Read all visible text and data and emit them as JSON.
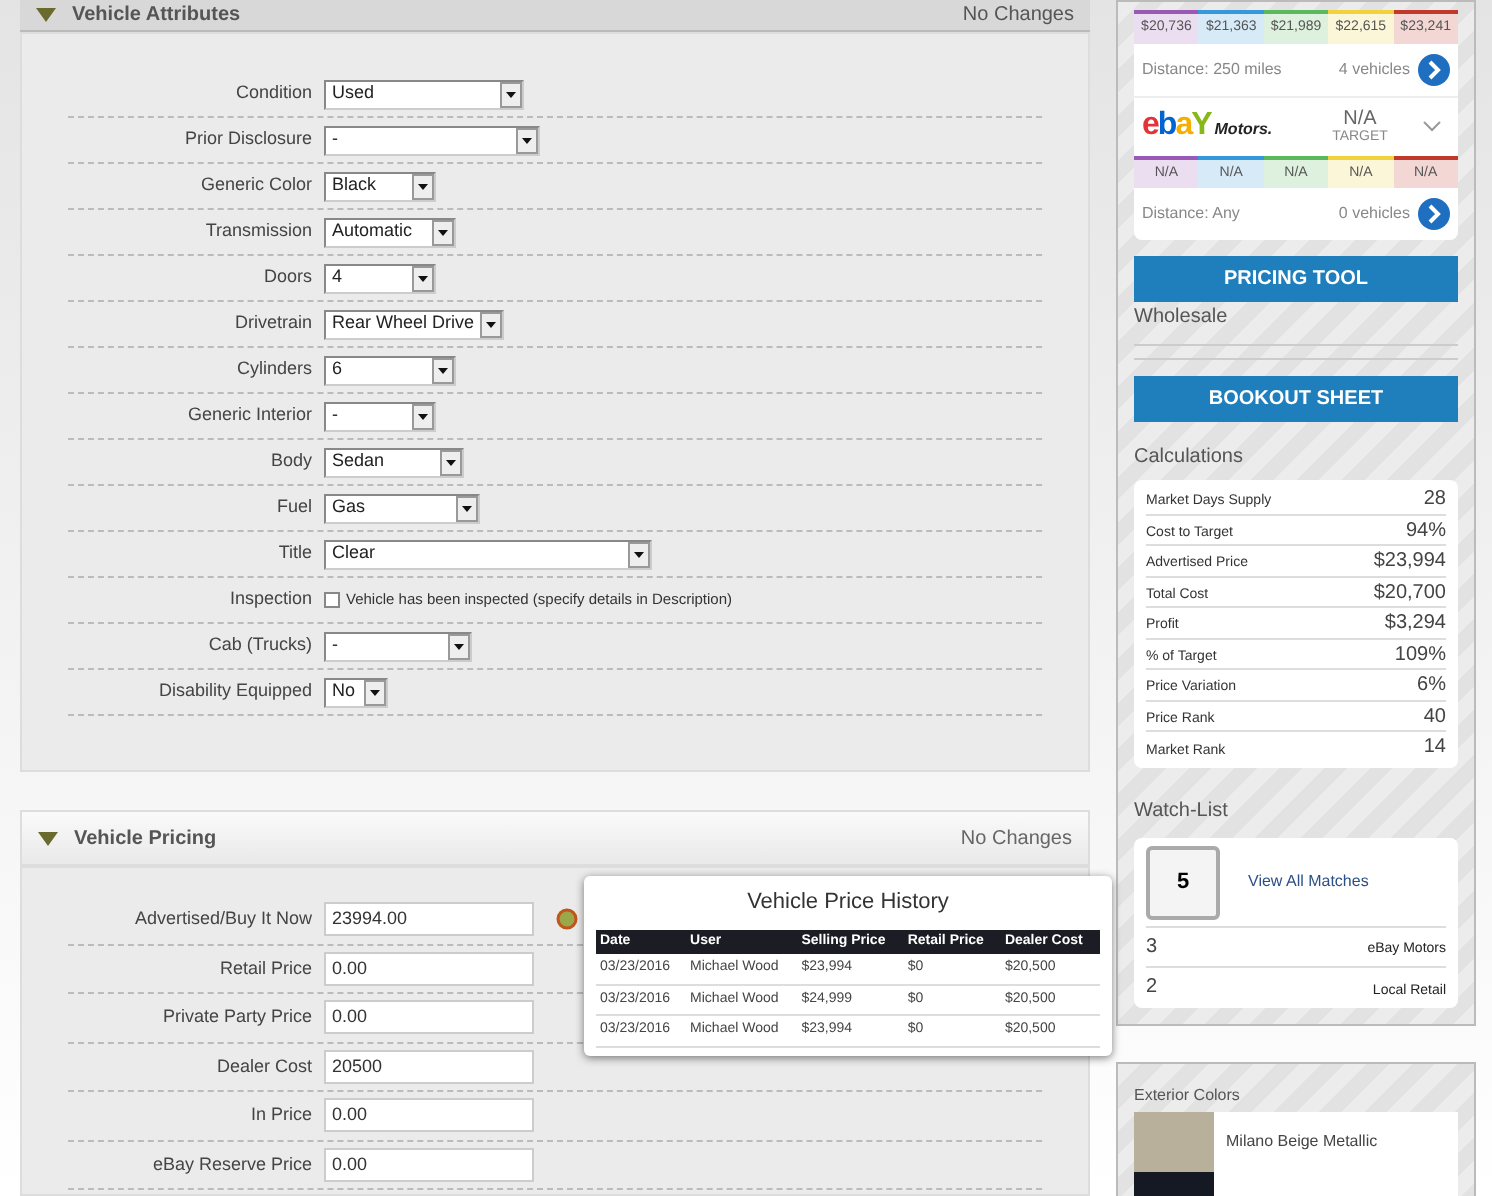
{
  "attributes_panel": {
    "title": "Vehicle Attributes",
    "status": "No Changes",
    "expanded": true,
    "rows": [
      {
        "kind": "select",
        "label": "Condition",
        "value": "Used"
      },
      {
        "kind": "select",
        "label": "Prior Disclosure",
        "value": "-"
      },
      {
        "kind": "select",
        "label": "Generic Color",
        "value": "Black"
      },
      {
        "kind": "select",
        "label": "Transmission",
        "value": "Automatic"
      },
      {
        "kind": "select",
        "label": "Doors",
        "value": "4"
      },
      {
        "kind": "select",
        "label": "Drivetrain",
        "value": "Rear Wheel Drive"
      },
      {
        "kind": "select",
        "label": "Cylinders",
        "value": "6"
      },
      {
        "kind": "select",
        "label": "Generic Interior",
        "value": "-"
      },
      {
        "kind": "select",
        "label": "Body",
        "value": "Sedan"
      },
      {
        "kind": "select",
        "label": "Fuel",
        "value": "Gas"
      },
      {
        "kind": "select",
        "label": "Title",
        "value": "Clear"
      },
      {
        "kind": "checkbox",
        "label": "Inspection",
        "text": "Vehicle has been inspected (specify details in Description)",
        "checked": false
      },
      {
        "kind": "select",
        "label": "Cab (Trucks)",
        "value": "-"
      },
      {
        "kind": "select",
        "label": "Disability Equipped",
        "value": "No"
      }
    ]
  },
  "pricing_panel": {
    "title": "Vehicle Pricing",
    "status": "No Changes",
    "expanded": true,
    "rows": [
      {
        "label": "Advertised/Buy It Now",
        "value": "23994.00",
        "history": true
      },
      {
        "label": "Retail Price",
        "value": "0.00",
        "history": false
      },
      {
        "label": "Private Party Price",
        "value": "0.00",
        "history": false
      },
      {
        "label": "Dealer Cost",
        "value": "20500",
        "history": false
      },
      {
        "label": "In Price",
        "value": "0.00",
        "history": false
      },
      {
        "label": "eBay Reserve Price",
        "value": "0.00",
        "history": false
      }
    ]
  },
  "price_history_popup": {
    "title": "Vehicle Price History",
    "columns": [
      "Date",
      "User",
      "Selling Price",
      "Retail Price",
      "Dealer Cost"
    ],
    "rows": [
      [
        "03/23/2016",
        "Michael Wood",
        "$23,994",
        "$0",
        "$20,500"
      ],
      [
        "03/23/2016",
        "Michael Wood",
        "$24,999",
        "$0",
        "$20,500"
      ],
      [
        "03/23/2016",
        "Michael Wood",
        "$23,994",
        "$0",
        "$20,500"
      ]
    ]
  },
  "market_card": {
    "local": {
      "price_bands": [
        {
          "value": "$20,736",
          "color": "#9b59b6"
        },
        {
          "value": "$21,363",
          "color": "#3498db"
        },
        {
          "value": "$21,989",
          "color": "#5cb85c"
        },
        {
          "value": "$22,615",
          "color": "#f0d33c"
        },
        {
          "value": "$23,241",
          "color": "#c0392b"
        }
      ],
      "distance": "Distance: 250 miles",
      "vehicles": "4 vehicles"
    },
    "ebay": {
      "logo_letters": [
        {
          "char": "e",
          "color": "#e53238"
        },
        {
          "char": "b",
          "color": "#0064d2"
        },
        {
          "char": "a",
          "color": "#f5af02"
        },
        {
          "char": "Y",
          "color": "#86b817"
        }
      ],
      "logo_suffix": "Motors.",
      "target_value": "N/A",
      "target_label": "TARGET",
      "price_bands": [
        {
          "value": "N/A",
          "color": "#9b59b6"
        },
        {
          "value": "N/A",
          "color": "#3498db"
        },
        {
          "value": "N/A",
          "color": "#5cb85c"
        },
        {
          "value": "N/A",
          "color": "#f0d33c"
        },
        {
          "value": "N/A",
          "color": "#c0392b"
        }
      ],
      "distance": "Distance: Any",
      "vehicles": "0 vehicles"
    }
  },
  "pricing_tool_button": "PRICING TOOL",
  "wholesale_label": "Wholesale",
  "bookout_sheet_button": "BOOKOUT SHEET",
  "calculations": {
    "title": "Calculations",
    "rows": [
      {
        "label": "Market Days Supply",
        "value": "28"
      },
      {
        "label": "Cost to Target",
        "value": "94%"
      },
      {
        "label": "Advertised Price",
        "value": "$23,994"
      },
      {
        "label": "Total Cost",
        "value": "$20,700"
      },
      {
        "label": "Profit",
        "value": "$3,294"
      },
      {
        "label": "% of Target",
        "value": "109%"
      },
      {
        "label": "Price Variation",
        "value": "6%"
      },
      {
        "label": "Price Rank",
        "value": "40"
      },
      {
        "label": "Market Rank",
        "value": "14"
      }
    ]
  },
  "watch_list": {
    "title": "Watch-List",
    "count": "5",
    "link": "View All Matches",
    "rows": [
      {
        "count": "3",
        "source": "eBay Motors"
      },
      {
        "count": "2",
        "source": "Local Retail"
      }
    ]
  },
  "exterior_colors": {
    "title": "Exterior Colors",
    "swatches": [
      {
        "color": "#b9b09c",
        "name": "Milano Beige Metallic"
      },
      {
        "color": "#151923"
      }
    ]
  }
}
